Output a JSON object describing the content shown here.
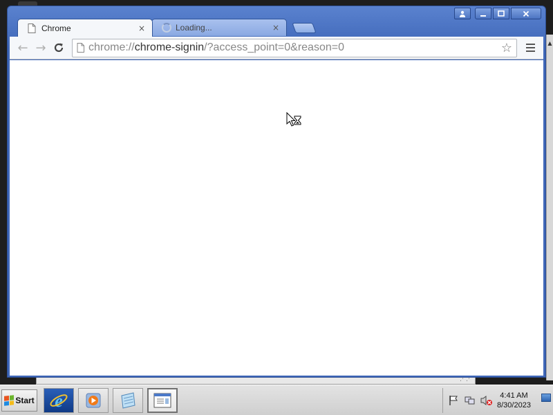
{
  "browser": {
    "tabs": [
      {
        "title": "Chrome",
        "close": "×",
        "active": true
      },
      {
        "title": "Loading...",
        "close": "×",
        "active": false
      }
    ],
    "window_controls": {
      "profile": "👤",
      "minimize": "–",
      "maximize": "□",
      "close": "✕"
    },
    "toolbar": {
      "back": "←",
      "forward": "→",
      "reload": "C",
      "star": "☆",
      "address": {
        "scheme": "chrome://",
        "host": "chrome-signin",
        "path": "/?access_point=0&reason=0"
      }
    }
  },
  "taskbar": {
    "start_label": "Start",
    "clock": {
      "time": "4:41 AM",
      "date": "8/30/2023"
    },
    "apps": [
      {
        "name": "internet-explorer"
      },
      {
        "name": "media-player"
      },
      {
        "name": "notepad"
      },
      {
        "name": "window-app"
      }
    ]
  },
  "colors": {
    "title_bar": "#3f67b8",
    "taskbar": "#d6d6d6",
    "content": "#ffffff"
  },
  "icons": [
    "page-icon",
    "spinner-icon",
    "back-icon",
    "forward-icon",
    "reload-icon",
    "star-icon",
    "menu-icon",
    "busy-cursor-icon",
    "windows-flag-icon",
    "action-center-icon",
    "network-icon",
    "volume-muted-icon",
    "show-desktop-icon"
  ]
}
